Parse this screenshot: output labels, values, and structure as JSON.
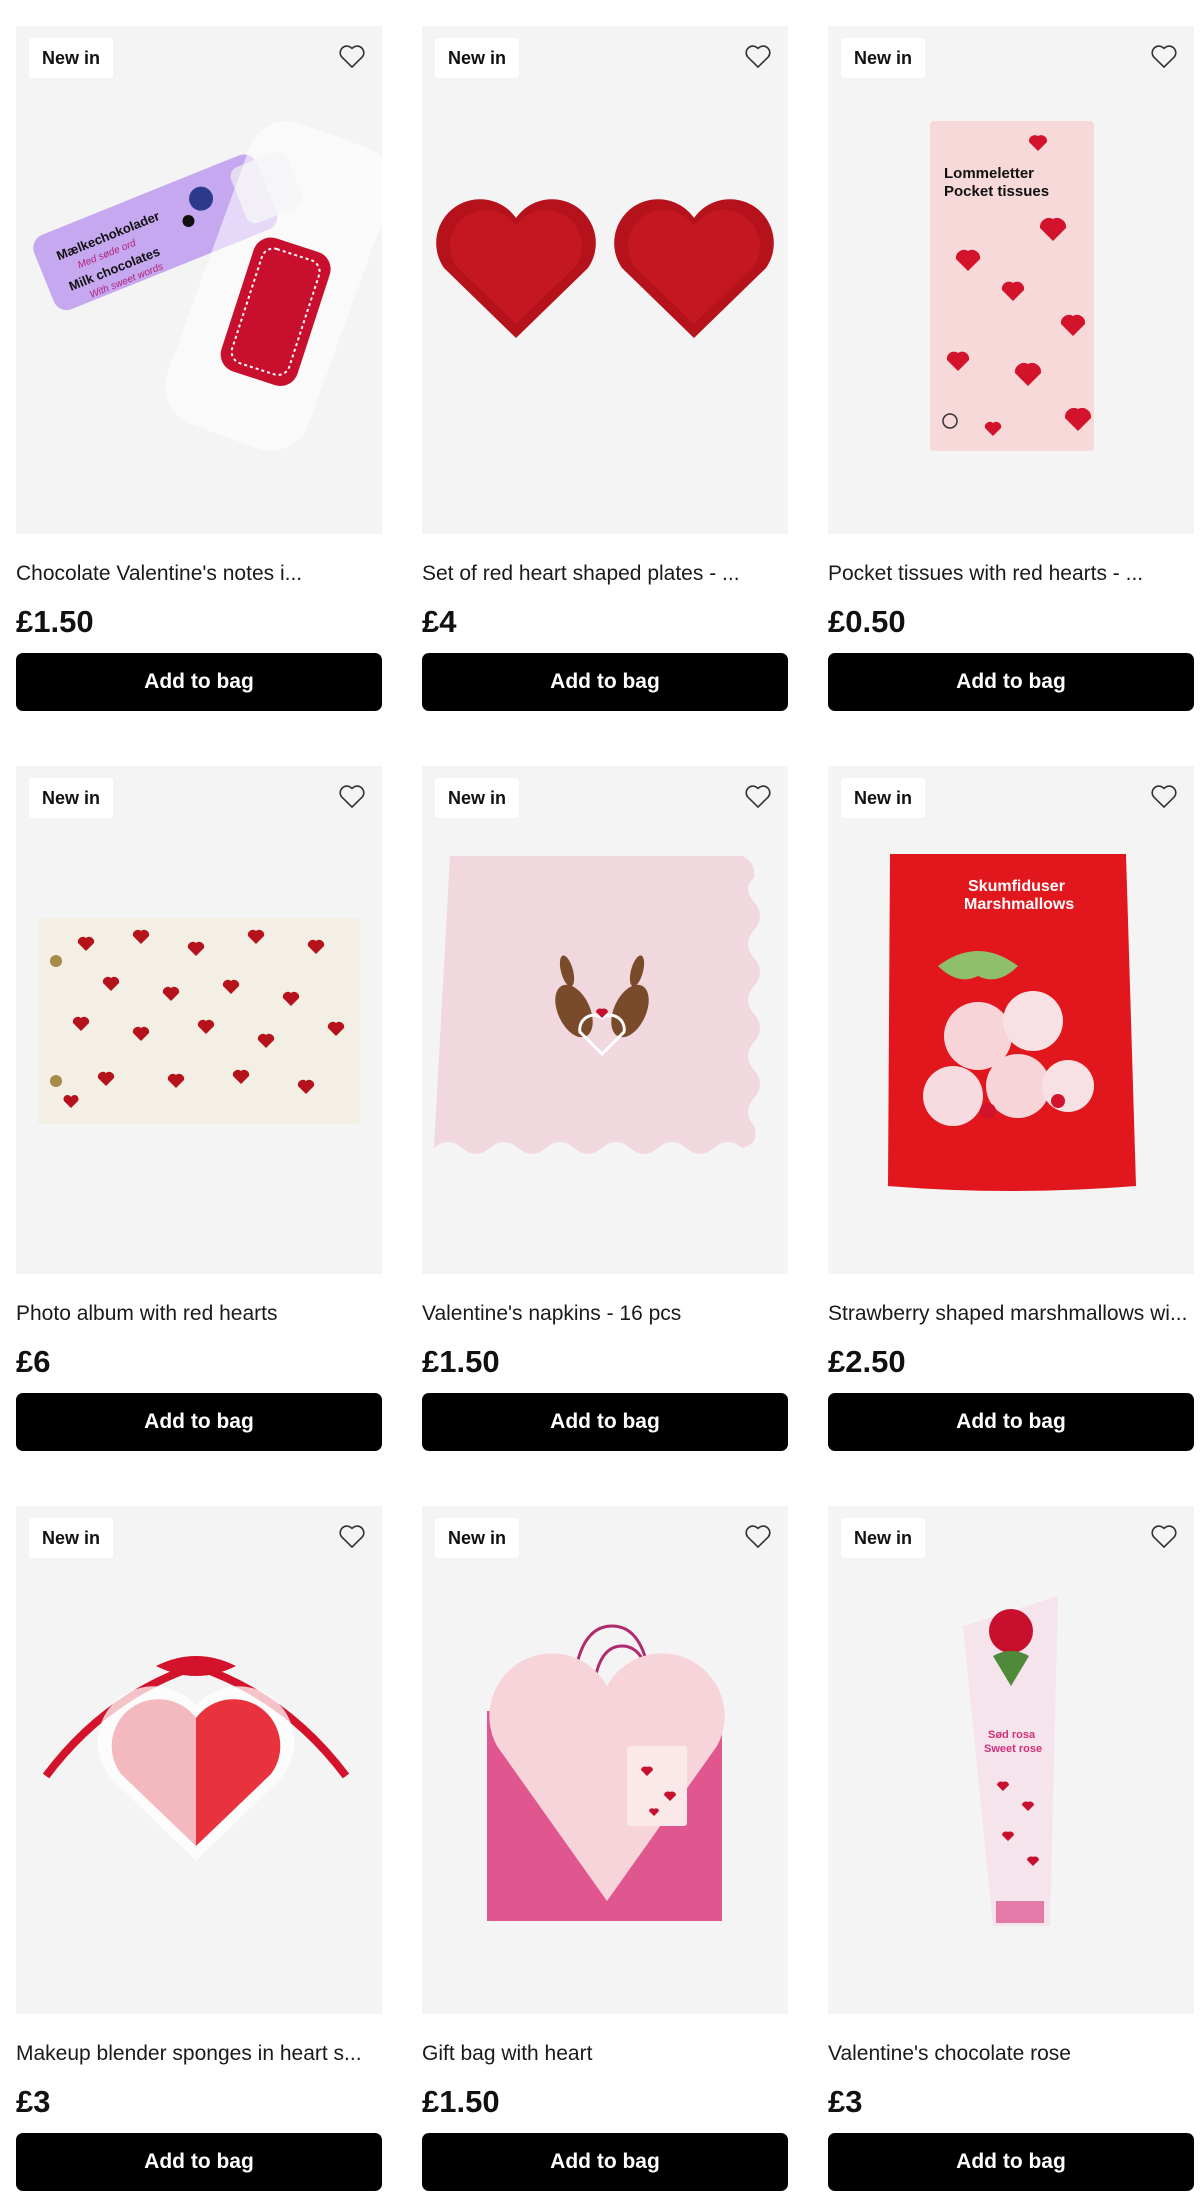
{
  "products": [
    {
      "badge": "New in",
      "name": "Chocolate Valentine's notes i...",
      "price": "£1.50",
      "cta": "Add to bag",
      "image_icon": "chocolate-notes-image"
    },
    {
      "badge": "New in",
      "name": "Set of red heart shaped plates - ...",
      "price": "£4",
      "cta": "Add to bag",
      "image_icon": "heart-plates-image"
    },
    {
      "badge": "New in",
      "name": "Pocket tissues with red hearts - ...",
      "price": "£0.50",
      "cta": "Add to bag",
      "image_icon": "pocket-tissues-image"
    },
    {
      "badge": "New in",
      "name": "Photo album with red hearts",
      "price": "£6",
      "cta": "Add to bag",
      "image_icon": "photo-album-image"
    },
    {
      "badge": "New in",
      "name": "Valentine's napkins - 16 pcs",
      "price": "£1.50",
      "cta": "Add to bag",
      "image_icon": "napkins-image"
    },
    {
      "badge": "New in",
      "name": "Strawberry shaped marshmallows wi...",
      "price": "£2.50",
      "cta": "Add to bag",
      "image_icon": "marshmallows-image"
    },
    {
      "badge": "New in",
      "name": "Makeup blender sponges in heart s...",
      "price": "£3",
      "cta": "Add to bag",
      "image_icon": "blender-sponges-image"
    },
    {
      "badge": "New in",
      "name": "Gift bag with heart",
      "price": "£1.50",
      "cta": "Add to bag",
      "image_icon": "gift-bag-image"
    },
    {
      "badge": "New in",
      "name": "Valentine's chocolate rose",
      "price": "£3",
      "cta": "Add to bag",
      "image_icon": "chocolate-rose-image"
    }
  ],
  "packaging_text": {
    "chocolate_da": "Mælkechokolader",
    "chocolate_da_sub": "Med søde ord",
    "chocolate_en": "Milk chocolates",
    "chocolate_en_sub": "With sweet words",
    "tissues_da": "Lommeletter",
    "tissues_en": "Pocket tissues",
    "marshmallow_da": "Skumfiduser",
    "marshmallow_en": "Marshmallows",
    "rose_da": "Sød rosa",
    "rose_en": "Sweet rose"
  },
  "colors": {
    "card_bg": "#f4f4f4",
    "button_bg": "#000000",
    "button_text": "#ffffff",
    "heart_red": "#c8102e",
    "lilac": "#c6a8f0",
    "pink": "#e85a9a"
  },
  "icons": {
    "favorite": "heart-outline-icon"
  }
}
